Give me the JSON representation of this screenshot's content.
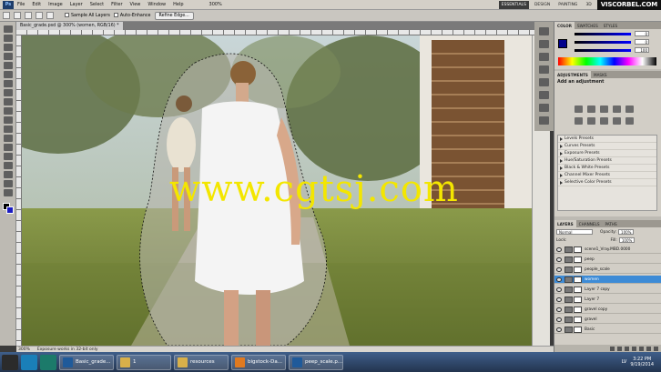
{
  "menubar": {
    "logo": "Ps",
    "items": [
      "File",
      "Edit",
      "Image",
      "Layer",
      "Select",
      "Filter",
      "View",
      "Window",
      "Help"
    ],
    "zoom_label": "300%",
    "workspaces": [
      "ESSENTIALS",
      "DESIGN",
      "PAINTING"
    ],
    "workspace_3d": "3D",
    "brand": "VISCORBEL.COM"
  },
  "options": {
    "sample_all_layers": "Sample All Layers",
    "auto_enhance": "Auto-Enhance",
    "refine_edge": "Refine Edge..."
  },
  "document": {
    "tab_title": "Basic_grade.psd @ 300% (women, RGB/16) *"
  },
  "status": {
    "zoom": "300%",
    "message": "Exposure works in 32-bit only"
  },
  "watermark": "www.cgtsj.com",
  "color_panel": {
    "tabs": [
      "COLOR",
      "SWATCHES",
      "STYLES"
    ],
    "values": [
      "0",
      "0",
      "100"
    ],
    "fg_color": "#00008c"
  },
  "adjustments_panel": {
    "tabs": [
      "ADJUSTMENTS",
      "MASKS"
    ],
    "title": "Add an adjustment",
    "presets": [
      "Levels Presets",
      "Curves Presets",
      "Exposure Presets",
      "Hue/Saturation Presets",
      "Black & White Presets",
      "Channel Mixer Presets",
      "Selective Color Presets"
    ]
  },
  "layers_panel": {
    "tabs": [
      "LAYERS",
      "CHANNELS",
      "PATHS"
    ],
    "blend_mode": "Normal",
    "opacity_label": "Opacity:",
    "opacity_value": "100%",
    "lock_label": "Lock:",
    "fill_label": "Fill:",
    "fill_value": "100%",
    "layers": [
      {
        "name": "scene1_Vray.MBD.0000",
        "selected": false
      },
      {
        "name": "peep",
        "selected": false
      },
      {
        "name": "people_scale",
        "selected": false
      },
      {
        "name": "women",
        "selected": true
      },
      {
        "name": "Layer 7 copy",
        "selected": false
      },
      {
        "name": "Layer 7",
        "selected": false
      },
      {
        "name": "gravel copy",
        "selected": false
      },
      {
        "name": "gravel",
        "selected": false
      },
      {
        "name": "Basic",
        "selected": false
      }
    ]
  },
  "taskbar": {
    "buttons": [
      {
        "label": "Basic_grade...",
        "color": "#1f5a9a"
      },
      {
        "label": "1",
        "color": "#d8b04a"
      },
      {
        "label": "resources",
        "color": "#d8b04a"
      },
      {
        "label": "bigstock-Da...",
        "color": "#e07a20"
      },
      {
        "label": "peep_scale.p...",
        "color": "#1f5a9a"
      }
    ],
    "lang": "LV",
    "time": "3:22 PM",
    "date": "9/19/2014"
  }
}
